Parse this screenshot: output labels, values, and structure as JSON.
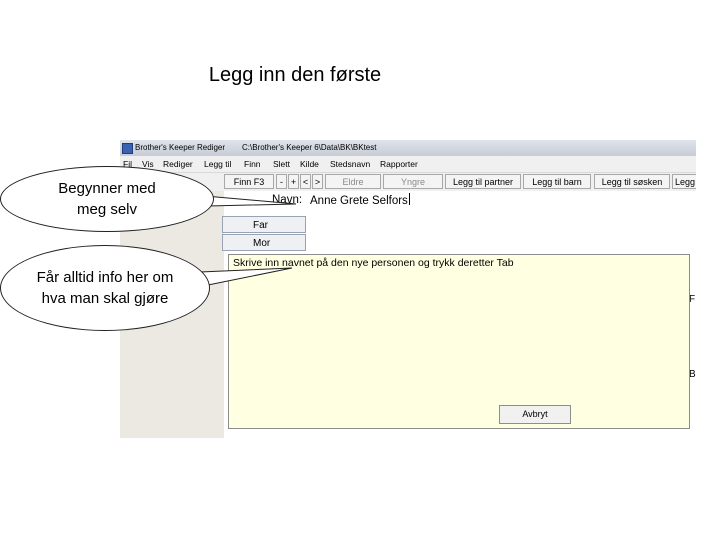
{
  "slide": {
    "title": "Legg inn den første"
  },
  "window": {
    "app_title": "Brother's Keeper Rediger",
    "path": "C:\\Brother's Keeper 6\\Data\\BK\\BKtest"
  },
  "menu": {
    "items": [
      "Fil",
      "Vis",
      "Rediger",
      "Legg til",
      "Finn",
      "Slett",
      "Kilde",
      "Stedsnavn",
      "Rapporter"
    ]
  },
  "toolbar": {
    "find": "Finn F3",
    "minus": "-",
    "plus": "+",
    "prev": "<",
    "next": ">",
    "older": "Eldre",
    "younger": "Yngre",
    "add_partner": "Legg til partner",
    "add_child": "Legg til barn",
    "add_sibling": "Legg til søsken",
    "add_more": "Legg"
  },
  "form": {
    "name_label": "Navn:",
    "name_value": "Anne Grete Selfors",
    "father": "Far",
    "mother": "Mor"
  },
  "info": {
    "text": "Skrive inn navnet på den nye personen og trykk deretter Tab",
    "cancel": "Avbryt"
  },
  "callouts": {
    "first": "Begynner med meg selv",
    "second": "Får alltid info her om hva man skal gjøre"
  },
  "edge": {
    "f": "F",
    "b": "B"
  }
}
